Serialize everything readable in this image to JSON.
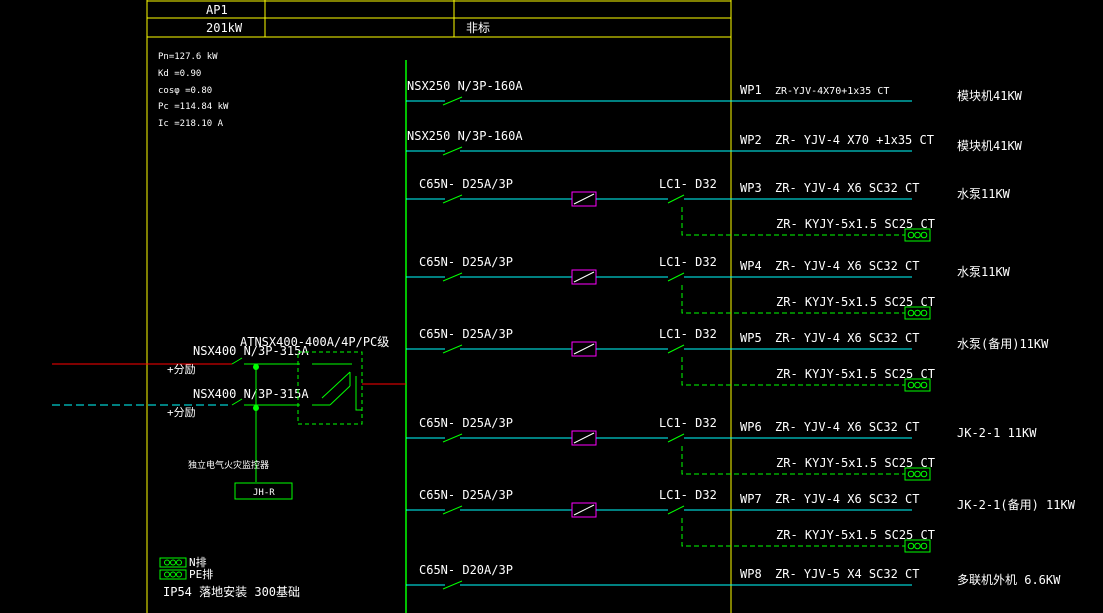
{
  "header": {
    "panel_name": "AP1",
    "power": "201kW",
    "category": "非标"
  },
  "params": [
    "Pn=127.6 kW",
    "Kd =0.90",
    "cosφ =0.80",
    "Pc =114.84 kW",
    "Ic =218.10 A"
  ],
  "incoming": {
    "breaker1": "NSX400 N/3P-315A",
    "breaker2": "NSX400 N/3P-315A",
    "shunt1": "+分励",
    "shunt2": "+分励",
    "ats": "ATNSX400-400A/4P/PC级",
    "monitor_label": "独立电气火灾监控器",
    "monitor_box": "JH-R"
  },
  "legend": {
    "n_bar": "N排",
    "pe_bar": "PE排",
    "install": "IP54  落地安装  300基础"
  },
  "circuits": [
    {
      "breaker": "NSX250 N/3P-160A",
      "id": "WP1",
      "cable": "ZR-YJV-4X70+1x35 CT",
      "load": "模块机41KW",
      "has_contactor": false
    },
    {
      "breaker": "NSX250 N/3P-160A",
      "id": "WP2",
      "cable": "ZR- YJV-4 X70 +1x35   CT",
      "load": "模块机41KW",
      "has_contactor": false
    },
    {
      "breaker": "C65N- D25A/3P",
      "contactor": "LC1- D32",
      "id": "WP3",
      "cable": "ZR- YJV-4 X6  SC32  CT",
      "control": "ZR- KYJY-5x1.5  SC25  CT",
      "load": "水泵11KW",
      "has_contactor": true
    },
    {
      "breaker": "C65N- D25A/3P",
      "contactor": "LC1- D32",
      "id": "WP4",
      "cable": "ZR- YJV-4 X6  SC32  CT",
      "control": "ZR- KYJY-5x1.5  SC25  CT",
      "load": "水泵11KW",
      "has_contactor": true
    },
    {
      "breaker": "C65N- D25A/3P",
      "contactor": "LC1- D32",
      "id": "WP5",
      "cable": "ZR- YJV-4 X6  SC32  CT",
      "control": "ZR- KYJY-5x1.5  SC25  CT",
      "load": "水泵(备用)11KW",
      "has_contactor": true
    },
    {
      "breaker": "C65N- D25A/3P",
      "contactor": "LC1- D32",
      "id": "WP6",
      "cable": "ZR- YJV-4 X6  SC32  CT",
      "control": "ZR- KYJY-5x1.5  SC25  CT",
      "load": "JK-2-1 11KW",
      "has_contactor": true
    },
    {
      "breaker": "C65N- D25A/3P",
      "contactor": "LC1- D32",
      "id": "WP7",
      "cable": "ZR- YJV-4 X6  SC32  CT",
      "control": "ZR- KYJY-5x1.5  SC25  CT",
      "load": "JK-2-1(备用) 11KW",
      "has_contactor": true
    },
    {
      "breaker": "C65N- D20A/3P",
      "id": "WP8",
      "cable": "ZR- YJV-5 X4  SC32  CT",
      "load": "多联机外机 6.6KW",
      "has_contactor": false
    }
  ],
  "colors": {
    "background": "#000000",
    "frame": "#ffff00",
    "text": "#ffffff",
    "wire": "#00ffff",
    "device": "#00ff00",
    "incoming_a": "#ff0000",
    "incoming_b": "#00ffff",
    "meter": "#ff00ff"
  }
}
